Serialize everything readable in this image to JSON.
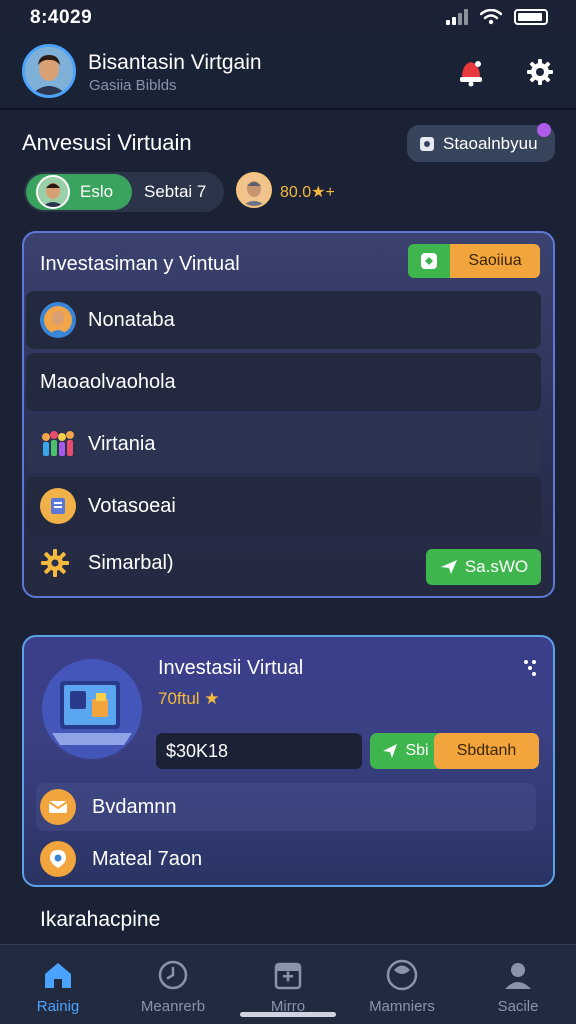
{
  "status_bar": {
    "time": "8:4029"
  },
  "header": {
    "title": "Bisantasin Virtgain",
    "subtitle": "Gasiia Biblds"
  },
  "section": {
    "title": "Anvesusi Virtuain",
    "chip_label": "Staoalnbyuu"
  },
  "user_switch": {
    "active_label": "Eslo",
    "other_label": "Sebtai 7",
    "rating": "80.0★+"
  },
  "card1": {
    "title": "Investasiman y Vintual",
    "button_label": "Saoiiua",
    "items": [
      {
        "label": "Nonataba",
        "icon": "user-avatar-icon"
      },
      {
        "label": "Maoaolvaohola",
        "icon": ""
      },
      {
        "label": "Virtania",
        "icon": "people-group-icon"
      },
      {
        "label": "Votasoeai",
        "icon": "document-icon"
      }
    ],
    "settings_label": "Simarbal)",
    "action_label": "Sa.sWO"
  },
  "card2": {
    "title": "Investasii Virtual",
    "rating": "70ftul ★",
    "amount": "$30K18",
    "action_left": "Sbi",
    "action_right": "Sbdtanh",
    "items": [
      {
        "label": "Bvdamnn",
        "icon": "mail-icon"
      },
      {
        "label": "Mateal 7aon",
        "icon": "location-pin-icon"
      }
    ]
  },
  "bottom_label": "Ikarahacpine",
  "nav": [
    {
      "label": "Rainig",
      "icon": "home-icon",
      "active": true
    },
    {
      "label": "Meanrerb",
      "icon": "clock-icon",
      "active": false
    },
    {
      "label": "Mirro",
      "icon": "calendar-icon",
      "active": false
    },
    {
      "label": "Mamniers",
      "icon": "circle-icon",
      "active": false
    },
    {
      "label": "Sacile",
      "icon": "profile-icon",
      "active": false
    }
  ],
  "colors": {
    "background": "#1b2236",
    "accent_blue": "#4aa3ff",
    "green": "#3fb54d",
    "orange": "#f3a53d",
    "gold": "#f5b93b"
  }
}
